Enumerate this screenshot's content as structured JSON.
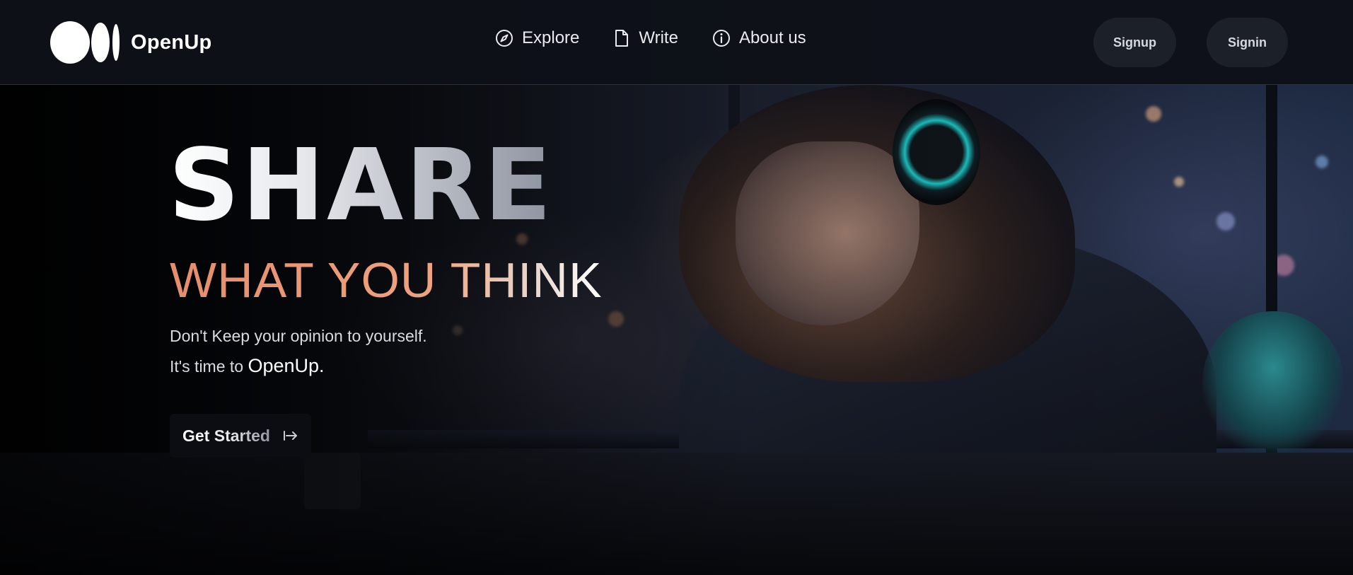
{
  "brand": {
    "name": "OpenUp"
  },
  "nav": {
    "links": [
      {
        "label": "Explore",
        "icon": "compass-icon"
      },
      {
        "label": "Write",
        "icon": "document-icon"
      },
      {
        "label": "About us",
        "icon": "info-icon"
      }
    ],
    "signup_label": "Signup",
    "signin_label": "Signin"
  },
  "hero": {
    "title": "SHARE",
    "subtitle": "WHAT YOU THINK",
    "line1": "Don't Keep your opinion to yourself.",
    "line2_prefix": "It's time to ",
    "line2_brand": "OpenUp.",
    "cta_label": "Get Started",
    "cta_icon": "arrow-right-from-bar-icon"
  },
  "colors": {
    "navbar": "#0e1118",
    "accent_orange": "#e58d6c",
    "button_bg": "#1c2029"
  }
}
